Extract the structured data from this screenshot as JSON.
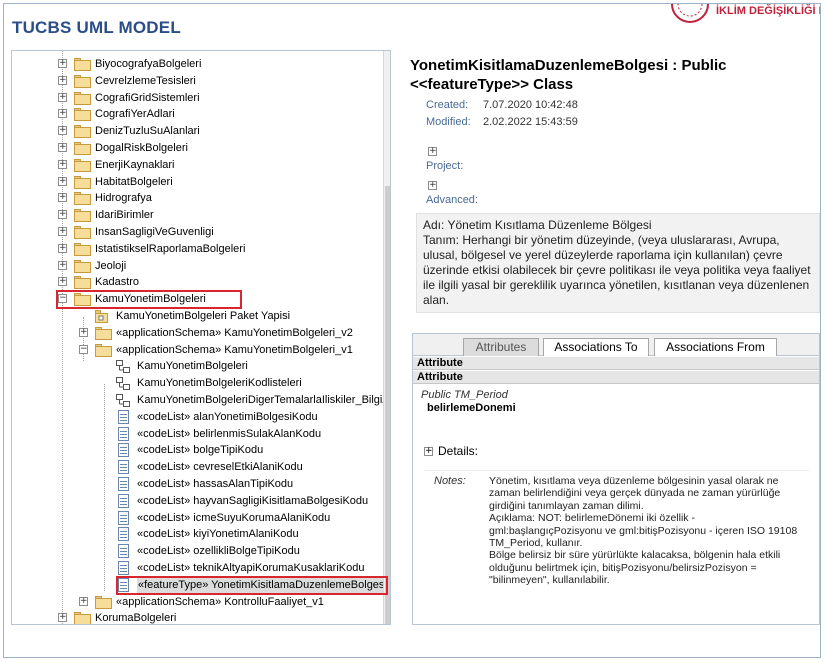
{
  "app": {
    "title": "TUCBS UML MODEL",
    "ministry_text": "İKLİM DEĞİŞİKLİĞİ BAKA"
  },
  "tree": {
    "items": [
      {
        "label": "BiyocografyaBolgeleri",
        "icon": "folder-icon",
        "expander": "plus"
      },
      {
        "label": "CevrelzlemeTesisleri",
        "icon": "folder-icon",
        "expander": "plus"
      },
      {
        "label": "CografiGridSistemleri",
        "icon": "folder-icon",
        "expander": "plus"
      },
      {
        "label": "CografiYerAdlari",
        "icon": "folder-icon",
        "expander": "plus"
      },
      {
        "label": "DenizTuzluSuAlanlari",
        "icon": "folder-icon",
        "expander": "plus"
      },
      {
        "label": "DogalRiskBolgeleri",
        "icon": "folder-icon",
        "expander": "plus"
      },
      {
        "label": "EnerjiKaynaklari",
        "icon": "folder-icon",
        "expander": "plus"
      },
      {
        "label": "HabitatBolgeleri",
        "icon": "folder-icon",
        "expander": "plus"
      },
      {
        "label": "Hidrografya",
        "icon": "folder-icon",
        "expander": "plus"
      },
      {
        "label": "IdariBirimler",
        "icon": "folder-icon",
        "expander": "plus"
      },
      {
        "label": "InsanSagligiVeGuvenligi",
        "icon": "folder-icon",
        "expander": "plus"
      },
      {
        "label": "IstatistikselRaporlamaBolgeleri",
        "icon": "folder-icon",
        "expander": "plus"
      },
      {
        "label": "Jeoloji",
        "icon": "folder-icon",
        "expander": "plus"
      },
      {
        "label": "Kadastro",
        "icon": "folder-icon",
        "expander": "plus"
      },
      {
        "label": "KamuYonetimBolgeleri",
        "icon": "folder-icon",
        "expander": "minus"
      },
      {
        "label": "KamuYonetimBolgeleri Paket Yapisi",
        "icon": "package-diagram-icon",
        "expander": "none"
      },
      {
        "label": "«applicationSchema» KamuYonetimBolgeleri_v2",
        "icon": "folder-icon",
        "expander": "plus"
      },
      {
        "label": "«applicationSchema» KamuYonetimBolgeleri_v1",
        "icon": "folder-icon",
        "expander": "minus"
      },
      {
        "label": "KamuYonetimBolgeleri",
        "icon": "class-diagram-icon",
        "expander": "none"
      },
      {
        "label": "KamuYonetimBolgeleriKodlisteleri",
        "icon": "class-diagram-icon",
        "expander": "none"
      },
      {
        "label": "KamuYonetimBolgeleriDigerTemalarlaIliskiler_BilgiA",
        "icon": "class-diagram-icon",
        "expander": "none"
      },
      {
        "label": "«codeList» alanYonetimiBolgesiKodu",
        "icon": "class-icon",
        "expander": "none"
      },
      {
        "label": "«codeList» belirlenmisSulakAlanKodu",
        "icon": "class-icon",
        "expander": "none"
      },
      {
        "label": "«codeList» bolgeTipiKodu",
        "icon": "class-icon",
        "expander": "none"
      },
      {
        "label": "«codeList» cevreselEtkiAlaniKodu",
        "icon": "class-icon",
        "expander": "none"
      },
      {
        "label": "«codeList» hassasAlanTipiKodu",
        "icon": "class-icon",
        "expander": "none"
      },
      {
        "label": "«codeList» hayvanSagligiKisitlamaBolgesiKodu",
        "icon": "class-icon",
        "expander": "none"
      },
      {
        "label": "«codeList» icmeSuyuKorumaAlaniKodu",
        "icon": "class-icon",
        "expander": "none"
      },
      {
        "label": "«codeList» kiyiYonetimAlaniKodu",
        "icon": "class-icon",
        "expander": "none"
      },
      {
        "label": "«codeList» ozellikliBolgeTipiKodu",
        "icon": "class-icon",
        "expander": "none"
      },
      {
        "label": "«codeList» teknikAltyapiKorumaKusaklariKodu",
        "icon": "class-icon",
        "expander": "none"
      },
      {
        "label": "«featureType» YonetimKisitlamaDuzenlemeBolgesi",
        "icon": "class-icon",
        "expander": "none",
        "selected": true
      },
      {
        "label": "«applicationSchema» KontrolluFaaliyet_v1",
        "icon": "folder-icon",
        "expander": "plus"
      },
      {
        "label": "KorumaBolgeleri",
        "icon": "folder-icon",
        "expander": "plus"
      }
    ]
  },
  "detail": {
    "title_line1": "YonetimKisitlamaDuzenlemeBolgesi : Public",
    "title_line2": "<<featureType>> Class",
    "created_label": "Created:",
    "created_value": "7.07.2020 10:42:48",
    "modified_label": "Modified:",
    "modified_value": "2.02.2022 15:43:59",
    "project_label": "Project:",
    "advanced_label": "Advanced:",
    "notes_line1": "Adı: Yönetim Kısıtlama Düzenleme Bölgesi",
    "notes_line2": "Tanım: Herhangi bir yönetim düzeyinde, (veya uluslararası, Avrupa, ulusal, bölgesel ve yerel düzeylerde raporlama için kullanılan) çevre üzerinde etkisi olabilecek bir çevre politikası ile veya politika veya faaliyet ile ilgili yasal bir gereklilik uyarınca yönetilen, kısıtlanan veya düzenlenen alan."
  },
  "tabs": {
    "attributes": "Attributes",
    "associations_to": "Associations To",
    "associations_from": "Associations From"
  },
  "attributes": {
    "header1": "Attribute",
    "header2": "Attribute",
    "row_type": "Public TM_Period",
    "row_name": "belirlemeDonemi",
    "details_label": "Details:",
    "notes_key": "Notes:",
    "notes_para1": "Yönetim, kısıtlama veya düzenleme bölgesinin yasal olarak ne zaman belirlendiğini veya gerçek dünyada ne zaman yürürlüğe girdiğini tanımlayan zaman dilimi.",
    "notes_para2": "Açıklama: NOT: belirlemeDönemi iki özellik - gml:başlangıçPozisyonu ve gml:bitişPozisyonu - içeren ISO 19108 TM_Period, kullanır.",
    "notes_para3": "Bölge belirsiz bir süre yürürlükte kalacaksa, bölgenin hala etkili olduğunu belirtmek için, bitişPozisyonu/belirsizPozisyon = \"bilinmeyen\", kullanılabilir."
  }
}
